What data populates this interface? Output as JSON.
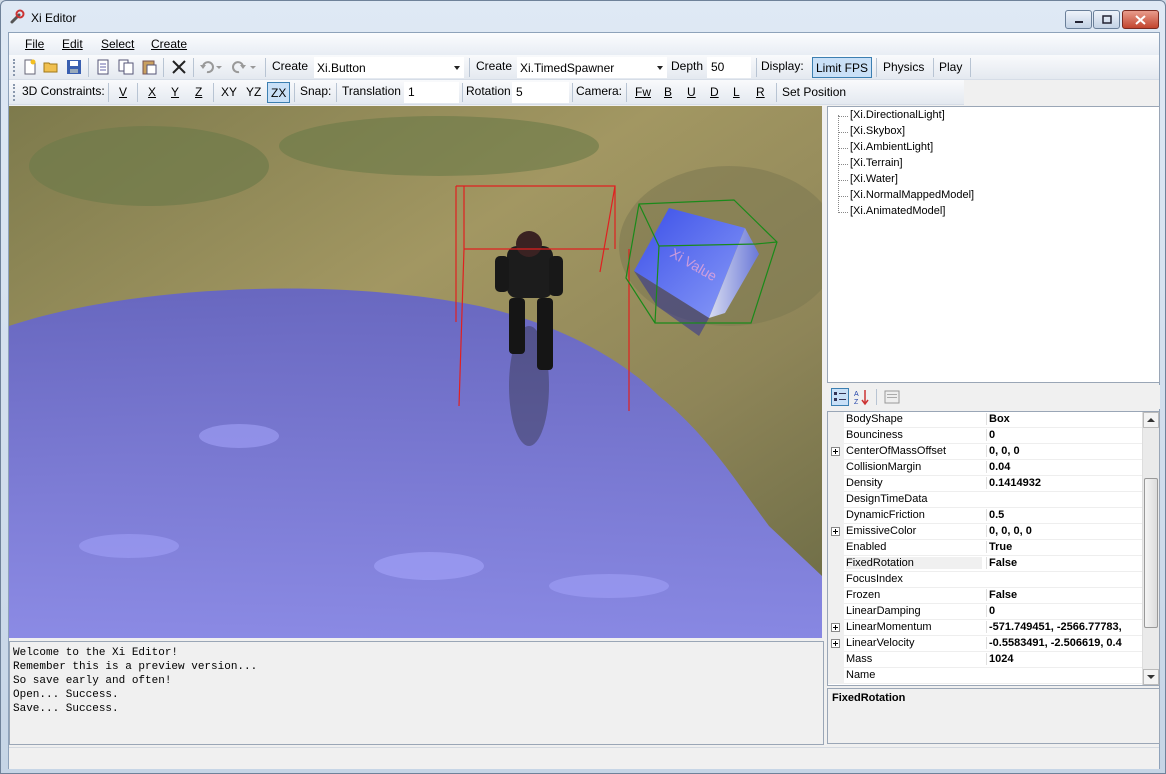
{
  "window": {
    "title": "Xi Editor",
    "icon": "wrench-icon",
    "controls": [
      "minimize-icon",
      "maximize-icon",
      "close-icon"
    ]
  },
  "menu": {
    "file": "File",
    "edit": "Edit",
    "select": "Select",
    "create": "Create"
  },
  "toolbar1": {
    "icons": [
      "new-document-icon",
      "open-folder-icon",
      "save-icon",
      "page-icon",
      "copy-icon",
      "paste-icon",
      "delete-x-icon",
      "undo-icon",
      "redo-icon"
    ],
    "create_label_1": "Create",
    "create_combo_1": "Xi.Button",
    "create_label_2": "Create",
    "create_combo_2": "Xi.TimedSpawner",
    "depth_label": "Depth",
    "depth_value": "50",
    "display_label": "Display:",
    "limit_fps": "Limit FPS",
    "physics": "Physics",
    "play": "Play"
  },
  "toolbar2": {
    "constraints_label": "3D Constraints:",
    "v": "V",
    "x": "X",
    "y": "Y",
    "z": "Z",
    "xy": "XY",
    "yz": "YZ",
    "zx": "ZX",
    "snap_label": "Snap:",
    "translation_label": "Translation",
    "translation_value": "1",
    "rotation_label": "Rotation",
    "rotation_value": "5",
    "camera_label": "Camera:",
    "fw": "Fw",
    "b": "B",
    "u": "U",
    "d": "D",
    "l": "L",
    "r": "R",
    "set_position": "Set Position"
  },
  "scene_tree": [
    "[Xi.DirectionalLight]",
    "[Xi.Skybox]",
    "[Xi.AmbientLight]",
    "[Xi.Terrain]",
    "[Xi.Water]",
    "[Xi.NormalMappedModel]",
    "[Xi.AnimatedModel]"
  ],
  "property_toolbar_icons": [
    "categorized-icon",
    "alphabetical-sort-icon",
    "property-pages-icon"
  ],
  "properties": [
    {
      "name": "BodyShape",
      "value": "Box",
      "expandable": false
    },
    {
      "name": "Bounciness",
      "value": "0",
      "expandable": false
    },
    {
      "name": "CenterOfMassOffset",
      "value": "0, 0, 0",
      "expandable": true
    },
    {
      "name": "CollisionMargin",
      "value": "0.04",
      "expandable": false
    },
    {
      "name": "Density",
      "value": "0.1414932",
      "expandable": false
    },
    {
      "name": "DesignTimeData",
      "value": "",
      "expandable": false
    },
    {
      "name": "DynamicFriction",
      "value": "0.5",
      "expandable": false
    },
    {
      "name": "EmissiveColor",
      "value": "0, 0, 0, 0",
      "expandable": true
    },
    {
      "name": "Enabled",
      "value": "True",
      "expandable": false
    },
    {
      "name": "FixedRotation",
      "value": "False",
      "expandable": false,
      "selected": true
    },
    {
      "name": "FocusIndex",
      "value": "",
      "expandable": false
    },
    {
      "name": "Frozen",
      "value": "False",
      "expandable": false
    },
    {
      "name": "LinearDamping",
      "value": "0",
      "expandable": false
    },
    {
      "name": "LinearMomentum",
      "value": "-571.749451, -2566.77783,",
      "expandable": true
    },
    {
      "name": "LinearVelocity",
      "value": "-0.5583491, -2.506619, 0.4",
      "expandable": true
    },
    {
      "name": "Mass",
      "value": "1024",
      "expandable": false
    },
    {
      "name": "Name",
      "value": "",
      "expandable": false
    }
  ],
  "help": {
    "title": "FixedRotation"
  },
  "console": [
    "Welcome to the Xi Editor!",
    "Remember this is a preview version...",
    "So save early and often!",
    "Open... Success.",
    "Save... Success."
  ],
  "viewport": {
    "cube_text": "Xi Value"
  },
  "colors": {
    "selection_box": "#e02020",
    "cube_bounds": "#1a8a1a",
    "water": "#6e6ef0",
    "toggle_active": "#c9e0f7"
  }
}
